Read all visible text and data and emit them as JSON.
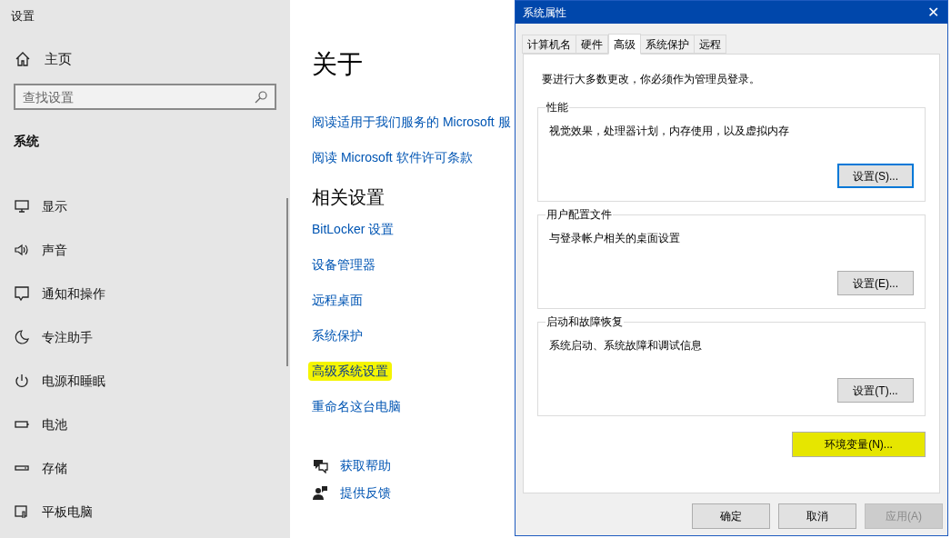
{
  "settings": {
    "title": "设置",
    "home": {
      "label": "主页"
    },
    "search": {
      "placeholder": "查找设置"
    },
    "section": "系统",
    "nav": [
      {
        "label": "显示",
        "kind": "display"
      },
      {
        "label": "声音",
        "kind": "sound"
      },
      {
        "label": "通知和操作",
        "kind": "notify"
      },
      {
        "label": "专注助手",
        "kind": "moon"
      },
      {
        "label": "电源和睡眠",
        "kind": "power"
      },
      {
        "label": "电池",
        "kind": "battery"
      },
      {
        "label": "存储",
        "kind": "storage"
      },
      {
        "label": "平板电脑",
        "kind": "tablet"
      }
    ],
    "page_title": "关于",
    "top_links": [
      {
        "label": "阅读适用于我们服务的 Microsoft 服"
      },
      {
        "label": "阅读 Microsoft 软件许可条款"
      }
    ],
    "related_title": "相关设置",
    "related_links": [
      {
        "label": "BitLocker 设置",
        "highlighted": false
      },
      {
        "label": "设备管理器",
        "highlighted": false
      },
      {
        "label": "远程桌面",
        "highlighted": false
      },
      {
        "label": "系统保护",
        "highlighted": false
      },
      {
        "label": "高级系统设置",
        "highlighted": true
      },
      {
        "label": "重命名这台电脑",
        "highlighted": false
      }
    ],
    "help": [
      {
        "label": "获取帮助",
        "kind": "help"
      },
      {
        "label": "提供反馈",
        "kind": "feedback"
      }
    ]
  },
  "dialog": {
    "title": "系统属性",
    "close": "✕",
    "tabs": [
      {
        "label": "计算机名",
        "selected": false
      },
      {
        "label": "硬件",
        "selected": false
      },
      {
        "label": "高级",
        "selected": true
      },
      {
        "label": "系统保护",
        "selected": false
      },
      {
        "label": "远程",
        "selected": false
      }
    ],
    "note": "要进行大多数更改，你必须作为管理员登录。",
    "groups": [
      {
        "title": "性能",
        "text": "视觉效果，处理器计划，内存使用，以及虚拟内存",
        "button": "设置(S)...",
        "focused": true
      },
      {
        "title": "用户配置文件",
        "text": "与登录帐户相关的桌面设置",
        "button": "设置(E)...",
        "focused": false
      },
      {
        "title": "启动和故障恢复",
        "text": "系统启动、系统故障和调试信息",
        "button": "设置(T)...",
        "focused": false
      }
    ],
    "env_button": {
      "label": "环境变量(N)...",
      "highlighted": true
    },
    "buttons": [
      {
        "label": "确定",
        "disabled": false
      },
      {
        "label": "取消",
        "disabled": false
      },
      {
        "label": "应用(A)",
        "disabled": true
      }
    ]
  }
}
